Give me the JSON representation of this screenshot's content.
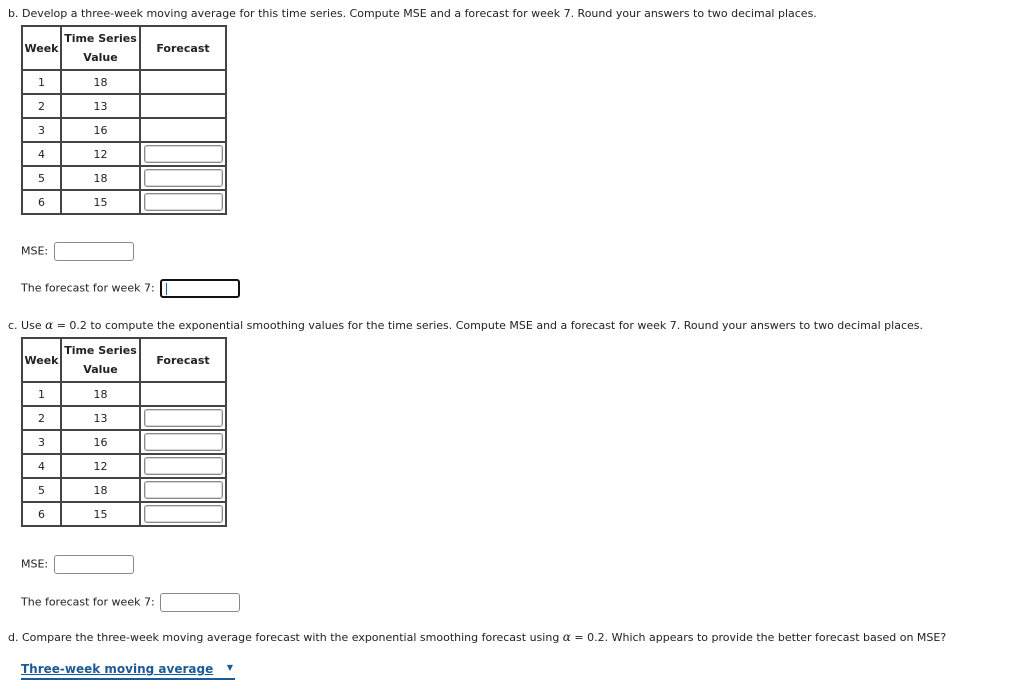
{
  "part_b": {
    "prompt": "b. Develop a three-week moving average for this time series. Compute MSE and a forecast for week 7. Round your answers to two decimal places.",
    "table": {
      "headers": [
        "Week",
        "Time Series",
        "Value",
        "Forecast"
      ],
      "rows": [
        {
          "week": "1",
          "value": "18",
          "forecast_input": false
        },
        {
          "week": "2",
          "value": "13",
          "forecast_input": false
        },
        {
          "week": "3",
          "value": "16",
          "forecast_input": false
        },
        {
          "week": "4",
          "value": "12",
          "forecast_input": true,
          "forecast_value": ""
        },
        {
          "week": "5",
          "value": "18",
          "forecast_input": true,
          "forecast_value": ""
        },
        {
          "week": "6",
          "value": "15",
          "forecast_input": true,
          "forecast_value": ""
        }
      ]
    },
    "mse_label": "MSE:",
    "mse_value": "",
    "week7_label": "The forecast for week 7:",
    "week7_value": ""
  },
  "part_c": {
    "prompt_prefix": "c. Use ",
    "alpha_symbol": "α",
    "prompt_suffix": " = 0.2 to compute the exponential smoothing values for the time series. Compute MSE and a forecast for week 7. Round your answers to two decimal places.",
    "table": {
      "headers": [
        "Week",
        "Time Series",
        "Value",
        "Forecast"
      ],
      "rows": [
        {
          "week": "1",
          "value": "18",
          "forecast_input": false
        },
        {
          "week": "2",
          "value": "13",
          "forecast_input": true,
          "forecast_value": ""
        },
        {
          "week": "3",
          "value": "16",
          "forecast_input": true,
          "forecast_value": ""
        },
        {
          "week": "4",
          "value": "12",
          "forecast_input": true,
          "forecast_value": ""
        },
        {
          "week": "5",
          "value": "18",
          "forecast_input": true,
          "forecast_value": ""
        },
        {
          "week": "6",
          "value": "15",
          "forecast_input": true,
          "forecast_value": ""
        }
      ]
    },
    "mse_label": "MSE:",
    "mse_value": "",
    "week7_label": "The forecast for week 7:",
    "week7_value": ""
  },
  "part_d": {
    "prompt_prefix": "d. Compare the three-week moving average forecast with the exponential smoothing forecast using ",
    "alpha_symbol": "α",
    "prompt_suffix": " = 0.2. Which appears to provide the better forecast based on MSE?",
    "dropdown_selected": "Three-week moving average",
    "dropdown_icon": "dropdown-arrow-icon"
  }
}
